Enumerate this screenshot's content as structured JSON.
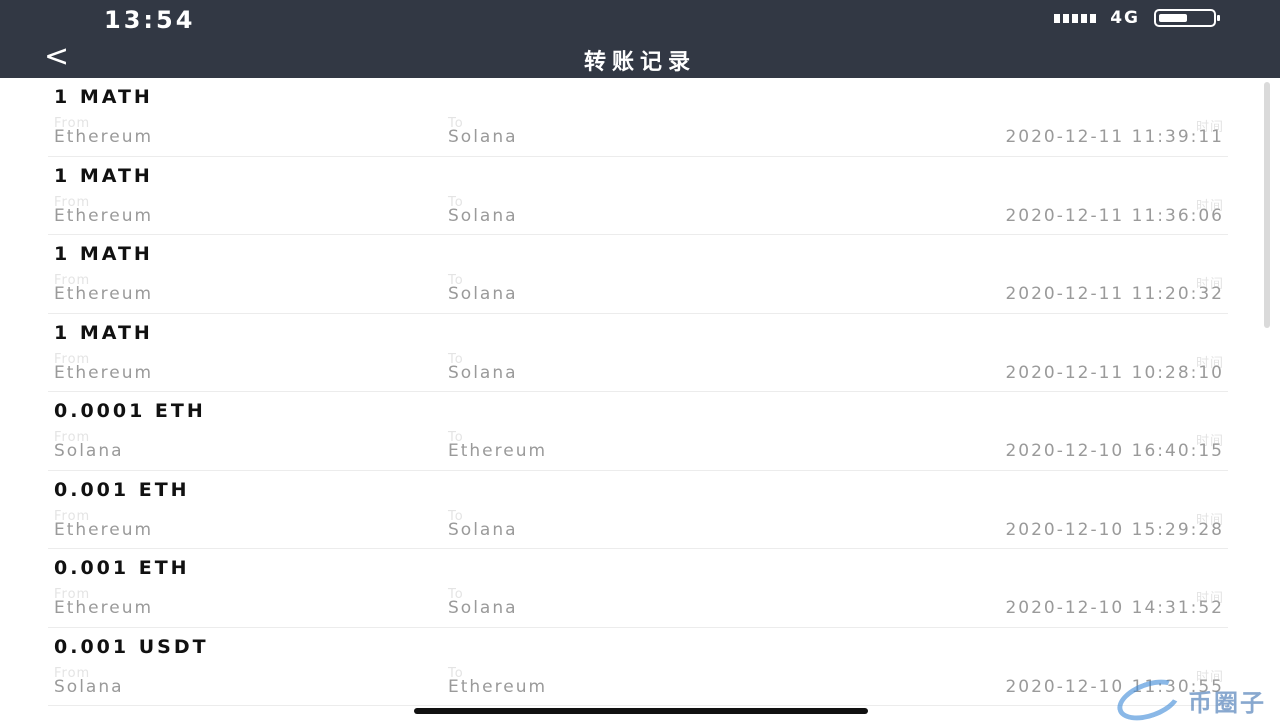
{
  "status_bar": {
    "time": "13:54",
    "network": "4G",
    "battery_level": 0.55
  },
  "header": {
    "back_icon": "<",
    "title": "转账记录"
  },
  "labels": {
    "from": "From",
    "to": "To",
    "time": "时间"
  },
  "records": [
    {
      "amount": "1 MATH",
      "from": "Ethereum",
      "to": "Solana",
      "time": "2020-12-11 11:39:11"
    },
    {
      "amount": "1 MATH",
      "from": "Ethereum",
      "to": "Solana",
      "time": "2020-12-11 11:36:06"
    },
    {
      "amount": "1 MATH",
      "from": "Ethereum",
      "to": "Solana",
      "time": "2020-12-11 11:20:32"
    },
    {
      "amount": "1 MATH",
      "from": "Ethereum",
      "to": "Solana",
      "time": "2020-12-11 10:28:10"
    },
    {
      "amount": "0.0001 ETH",
      "from": "Solana",
      "to": "Ethereum",
      "time": "2020-12-10 16:40:15"
    },
    {
      "amount": "0.001 ETH",
      "from": "Ethereum",
      "to": "Solana",
      "time": "2020-12-10 15:29:28"
    },
    {
      "amount": "0.001 ETH",
      "from": "Ethereum",
      "to": "Solana",
      "time": "2020-12-10 14:31:52"
    },
    {
      "amount": "0.001 USDT",
      "from": "Solana",
      "to": "Ethereum",
      "time": "2020-12-10 11:30:55"
    }
  ],
  "colors": {
    "header_bg": "#323844",
    "label_gray": "#e4e4e4",
    "value_gray": "#9a9a9a"
  },
  "watermark": {
    "text": "币圈子"
  }
}
